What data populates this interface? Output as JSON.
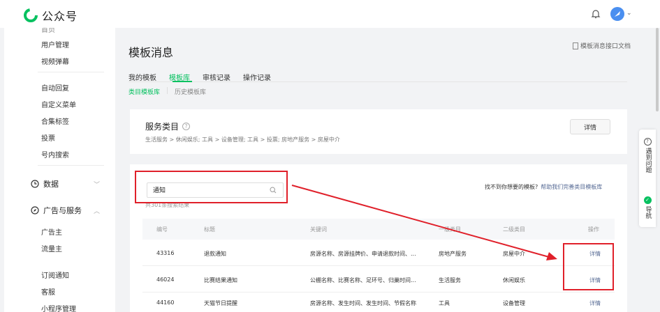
{
  "app": {
    "title": "公众号",
    "brand_color": "#07c160"
  },
  "header": {
    "bell_icon": "bell-icon",
    "avatar_icon": "avatar-icon",
    "avatar_caret": "⌄"
  },
  "sidebar": {
    "cut_item": "首页",
    "items_top": [
      "用户管理",
      "视频弹幕"
    ],
    "items_mid": [
      "自动回复",
      "自定义菜单",
      "合集标签",
      "投票",
      "号内搜索"
    ],
    "group_data": {
      "label": "数据",
      "icon": "clock-icon",
      "chevron": "﹀"
    },
    "group_ads": {
      "label": "广告与服务",
      "icon": "compass-icon",
      "chevron": "︿"
    },
    "items_ads": [
      "广告主",
      "流量主"
    ],
    "items_bottom": [
      "订阅通知",
      "客服",
      "小程序管理"
    ]
  },
  "page": {
    "title": "模板消息",
    "doc_link": "模板消息接口文档",
    "tabs": [
      {
        "label": "我的模板",
        "active": false
      },
      {
        "label": "模板库",
        "active": true
      },
      {
        "label": "审核记录",
        "active": false
      },
      {
        "label": "操作记录",
        "active": false
      }
    ],
    "subtabs": [
      {
        "label": "类目模板库",
        "active": true
      },
      {
        "label": "历史模板库",
        "active": false
      }
    ]
  },
  "service": {
    "title": "服务类目",
    "path": "生活服务 > 休闲娱乐; 工具 > 设备管理; 工具 > 投票; 房地产服务 > 房屋中介",
    "detail_button": "详情"
  },
  "search": {
    "value": "通知",
    "result_count": "共301条搜索结果",
    "help_text": "找不到你想要的模板?",
    "help_link": "帮助我们完善类目模板库"
  },
  "table": {
    "headers": [
      "编号",
      "标题",
      "关键词",
      "一级类目",
      "二级类目",
      "操作"
    ],
    "rows": [
      {
        "id": "43316",
        "title": "退款通知",
        "keywords": "房源名称、房源挂牌价、申请退款时间、...",
        "cat1": "房地产服务",
        "cat2": "房屋中介",
        "action": "详情"
      },
      {
        "id": "46024",
        "title": "比赛结果通知",
        "keywords": "公棚名称、比赛名称、足环号、归巢时间...",
        "cat1": "生活服务",
        "cat2": "休闲娱乐",
        "action": "详情"
      },
      {
        "id": "44160",
        "title": "天猫节日提醒",
        "keywords": "房源名称、发生时间、发生时间、节假名称",
        "cat1": "工具",
        "cat2": "设备管理",
        "action": "详情"
      }
    ]
  },
  "float_panel": {
    "help": {
      "label": "遇到问题",
      "icon": "question-icon"
    },
    "nav": {
      "label": "导航",
      "icon": "nav-icon"
    }
  },
  "annotation_color": "#e0202a"
}
